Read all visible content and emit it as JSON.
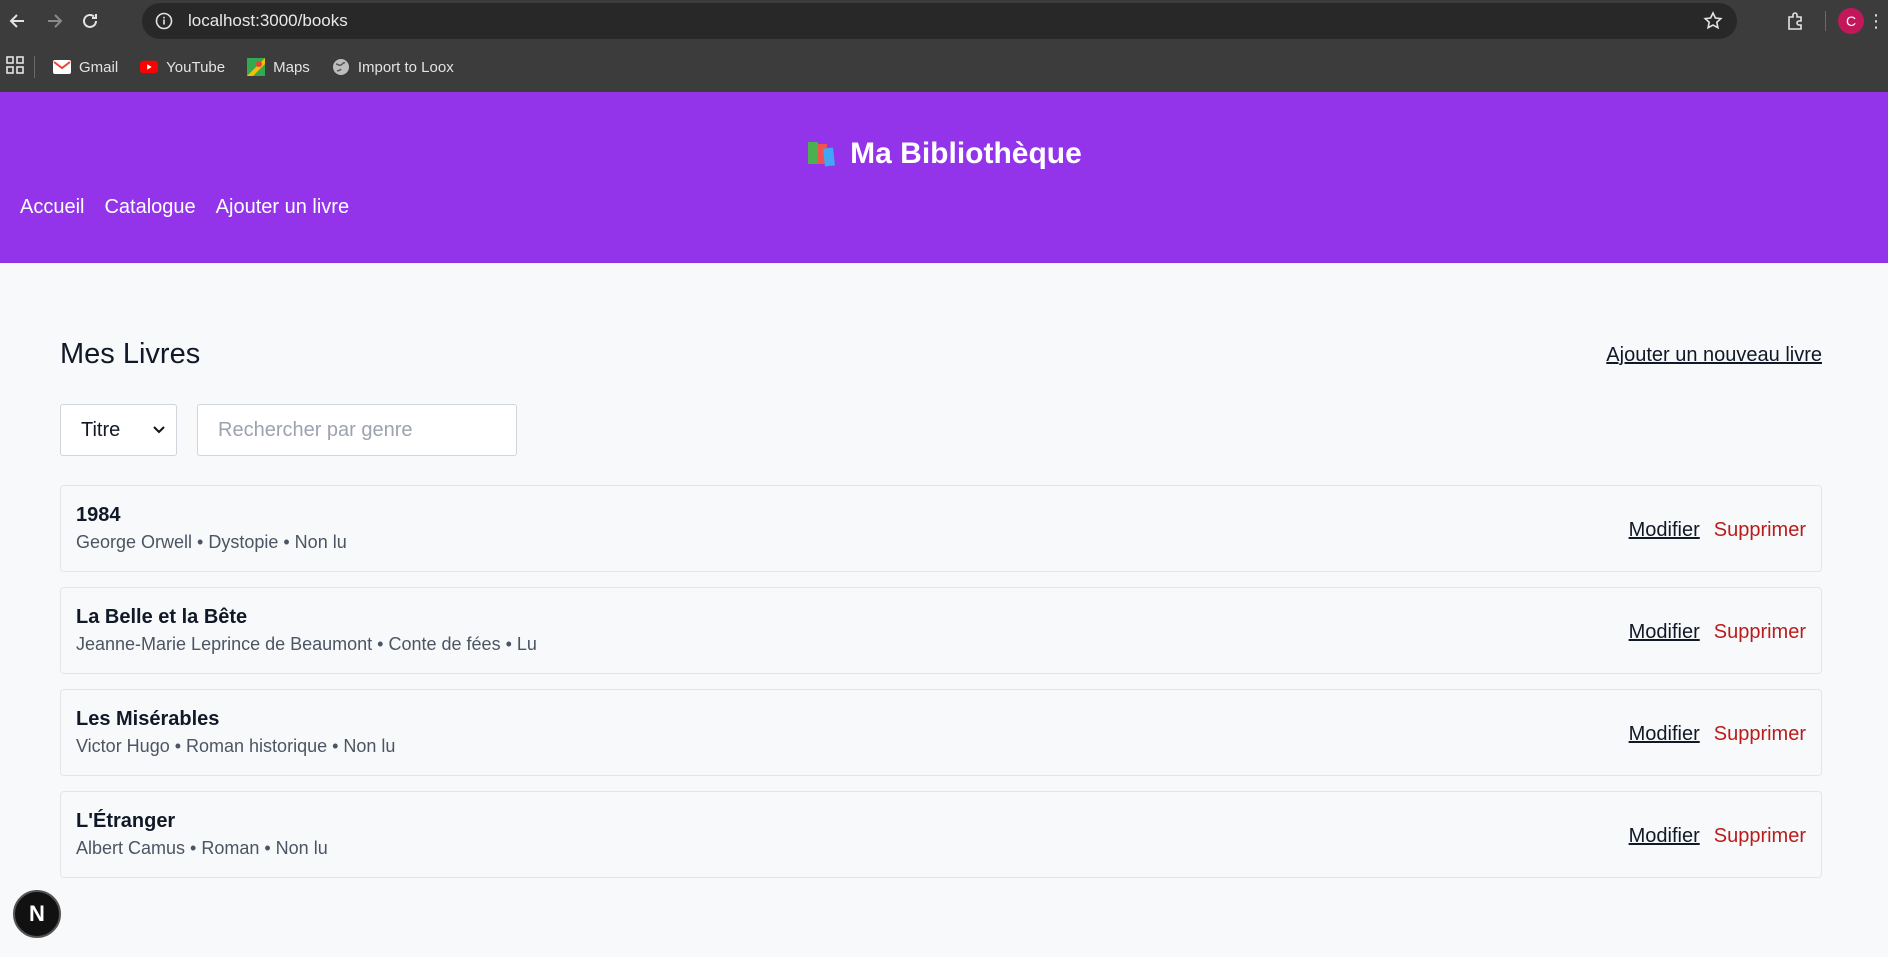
{
  "browser": {
    "url": "localhost:3000/books",
    "profile_initial": "C",
    "bookmarks": [
      {
        "label": "Gmail",
        "icon": "gmail-icon"
      },
      {
        "label": "YouTube",
        "icon": "youtube-icon"
      },
      {
        "label": "Maps",
        "icon": "maps-icon"
      },
      {
        "label": "Import to Loox",
        "icon": "globe-icon"
      }
    ]
  },
  "header": {
    "title": "Ma Bibliothèque",
    "nav": [
      "Accueil",
      "Catalogue",
      "Ajouter un livre"
    ]
  },
  "main": {
    "title": "Mes Livres",
    "add_link": "Ajouter un nouveau livre",
    "sort_select": {
      "value": "Titre"
    },
    "search_placeholder": "Rechercher par genre",
    "books": [
      {
        "title": "1984",
        "meta": "George Orwell • Dystopie • Non lu"
      },
      {
        "title": "La Belle et la Bête",
        "meta": "Jeanne-Marie Leprince de Beaumont • Conte de fées • Lu"
      },
      {
        "title": "Les Misérables",
        "meta": "Victor Hugo • Roman historique • Non lu"
      },
      {
        "title": "L'Étranger",
        "meta": "Albert Camus • Roman • Non lu"
      }
    ],
    "edit_label": "Modifier",
    "delete_label": "Supprimer"
  },
  "dev_badge": "N",
  "colors": {
    "header_bg": "#9333ea",
    "delete": "#b91c1c"
  }
}
